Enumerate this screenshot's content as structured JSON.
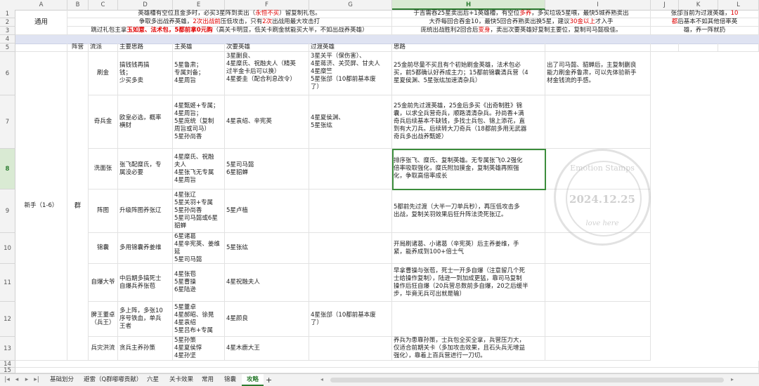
{
  "columns": [
    "A",
    "B",
    "C",
    "D",
    "E",
    "F",
    "G",
    "H",
    "I",
    "J",
    "K",
    "L"
  ],
  "selected_column": "H",
  "rows": [
    "1",
    "2",
    "3",
    "4",
    "5",
    "6",
    "7",
    "8",
    "9",
    "10",
    "11",
    "12",
    "13",
    "14",
    "15"
  ],
  "selected_row": "8",
  "top": {
    "a1": "通用",
    "b1_parts": [
      "英雄槽有空位且金多时，必买3星阵到卖出（",
      "永恒不买",
      "）留复制礼包。"
    ],
    "b2_parts": [
      "争取多出战养英雄，",
      "2次出战前",
      "压低攻击，只有",
      "2次",
      "出战用最大攻击打"
    ],
    "b3_parts": [
      "跳过礼包主拿",
      "玉如意、法术包，5都前拿0元购",
      "（高关卡明显，低关卡刷金就能买大半，不如出战养英雄）"
    ],
    "h1_parts": [
      "于吉需吞25星卖出后+1英雄槽，有空位",
      "多养",
      "，多买垃圾5星喂，最快5城养熟卖出"
    ],
    "h2": "大乔每回合吞金10，最快5回合养熟卖出换5星，建议",
    "h2_red": "30金以上",
    "h2_tail": "才入手",
    "h3_parts": [
      "庞统出战胜利2回合后",
      "变身",
      "，卖出次要英雄好复制主要位，复制司马懿极佳。"
    ],
    "j1_parts": [
      "张郃当前为过渡英雄，",
      "10"
    ],
    "j2_parts": [
      "都",
      "后基本不如其他倍率英"
    ],
    "j3": "雄，养一阵就扔"
  },
  "headers": {
    "b": "阵营",
    "c": "流派",
    "d": "主要思路",
    "e": "主英雄",
    "f": "次要英雄",
    "g": "过渡英雄",
    "h": "思路"
  },
  "group": {
    "a": "新手（1-6）",
    "b": "群"
  },
  "strategies": [
    {
      "row": "6",
      "c": "刷金",
      "d": "搞钱钱再搞\n钱；\n少买多卖",
      "e": "5星鲁肃；\n专属刘备；\n4星周旨",
      "f": "3星蒯良、\n4星糜氏、祝融夫人（精英\n过半金卡后可以换）\n4星娄圭（配合利息改令）",
      "g": "3星关平（保伤害）、\n4星蒋济、关荧屏、甘夫人\n4星糜竺\n5星张郃（10都前基本废\n了）",
      "h": "25金前尽量不买且有个初始刷金英雄，法术包必\n买，前5都确认好养成主力；15都前锦囊清兵营（4\n星夏侯渊、5星张纮加速清杂兵）",
      "i": "出了司马懿、貂蝉后，主复制蒯良\n能力刷金养鲁肃，可以先体验新手\n材金钱流的手感。"
    },
    {
      "row": "7",
      "c": "奇兵金",
      "d": "欧皇必选，概率\n横财",
      "e": "4星甄姬+专属；\n4星周旨；\n5星庞统（复制\n周旨或司马）\n5星孙尚香",
      "f": "4星袁绍、辛宪英",
      "g": "4星夏侯渊、\n5星张纮",
      "h": "25金前先过渡英雄，25金后多买《出奇制胜》锦\n囊，以求全兵营奇兵，顺路清清杂兵。孙尚香+满\n奇兵后续基本不缺钱，多找士兵包、锦上添花，直\n到有大刀兵。后续转大刀奇兵（18都前多用无武器\n奇兵多出战养甄姬）",
      "i": ""
    },
    {
      "row": "8",
      "c": "洗面张",
      "d": "张飞配糜氏，专\n属没必要",
      "e": "4星糜氏、祝融\n夫人\n4星张飞无专属\n4星周旨",
      "f": "5星司马懿\n6星貂蝉",
      "g": "",
      "h": "排序张飞、糜氏、复制英雄。无专属张飞0.2强化\n倍率吸取强化，糜氏附加摸金，复制英雄再照强\n化，争取高倍率成长",
      "i": ""
    },
    {
      "row": "9",
      "c": "阵图",
      "d": "升级阵图养张辽",
      "e": "4星张辽\n5星关羽+专属\n5星孙尚香\n5星司马懿或6星\n貂蝉",
      "f": "5星卢植",
      "g": "",
      "h": "5都前先过渡（大半一刀单兵秒），再压低攻击多\n出战，复制关羽效果后狂升阵法烫死张辽。",
      "i": ""
    },
    {
      "row": "10",
      "c": "锦囊",
      "d": "多用锦囊养姜维",
      "e": "6星诸葛\n4星辛宪英、姜维\n延\n5星司马懿",
      "f": "5星张纮",
      "g": "",
      "h": "开局刷诸葛、小诸葛（辛宪英）后主养姜维，手\n紧，能养成到100+倍士气",
      "i": ""
    },
    {
      "row": "11",
      "c": "自爆大爷",
      "d": "中后期多搞死士\n自爆兵养张苞",
      "e": "4星张苞\n5星曹操\n6星陆逊",
      "f": "4星祝融夫人",
      "g": "",
      "h": "早拿曹操与张苞，死士一开多自爆（注意留几个死\n士给操作复制），陆逊一到加成更猛，靠司马复制\n操作后狂自爆（20兵营总数前多自爆，20之后缓半\n步，毕竟无兵可出就是输）",
      "i": ""
    },
    {
      "row": "12",
      "c": "脾王董卓\n（兵王）",
      "d": "多上阵，多张10\n序号铁血，单兵\n王者",
      "e": "5星董卓\n4星郝昭、徐晃\n4星袁绍\n5星吕布+专属",
      "f": "4星颜良",
      "g": "4星张郃（10都前基本废\n了）",
      "h": "",
      "i": ""
    },
    {
      "row": "13",
      "c": "兵灾洪流",
      "d": "贪兵主养孙策",
      "e": "5星孙策\n4星夏侯惇\n4星孙坚",
      "f": "4星木鹿大王",
      "g": "",
      "h": "养兵为患靠孙策，士兵包全买全拿，兵营压力大，\n仅适合前期关卡（多加攻击效果，且石头兵无增益\n强化），靠着上百兵营进行一刀切。",
      "i": ""
    }
  ],
  "stamp": {
    "top_text": "Emotion Stamps",
    "date": "2024.12.25",
    "bottom_text": "love here"
  },
  "tabs": [
    "基础划分",
    "避雷（Q群嘟嘟贡献）",
    "六星",
    "关卡效果",
    "常用",
    "锦囊",
    "攻略"
  ],
  "active_tab": "攻略",
  "add_tab_symbol": "+"
}
